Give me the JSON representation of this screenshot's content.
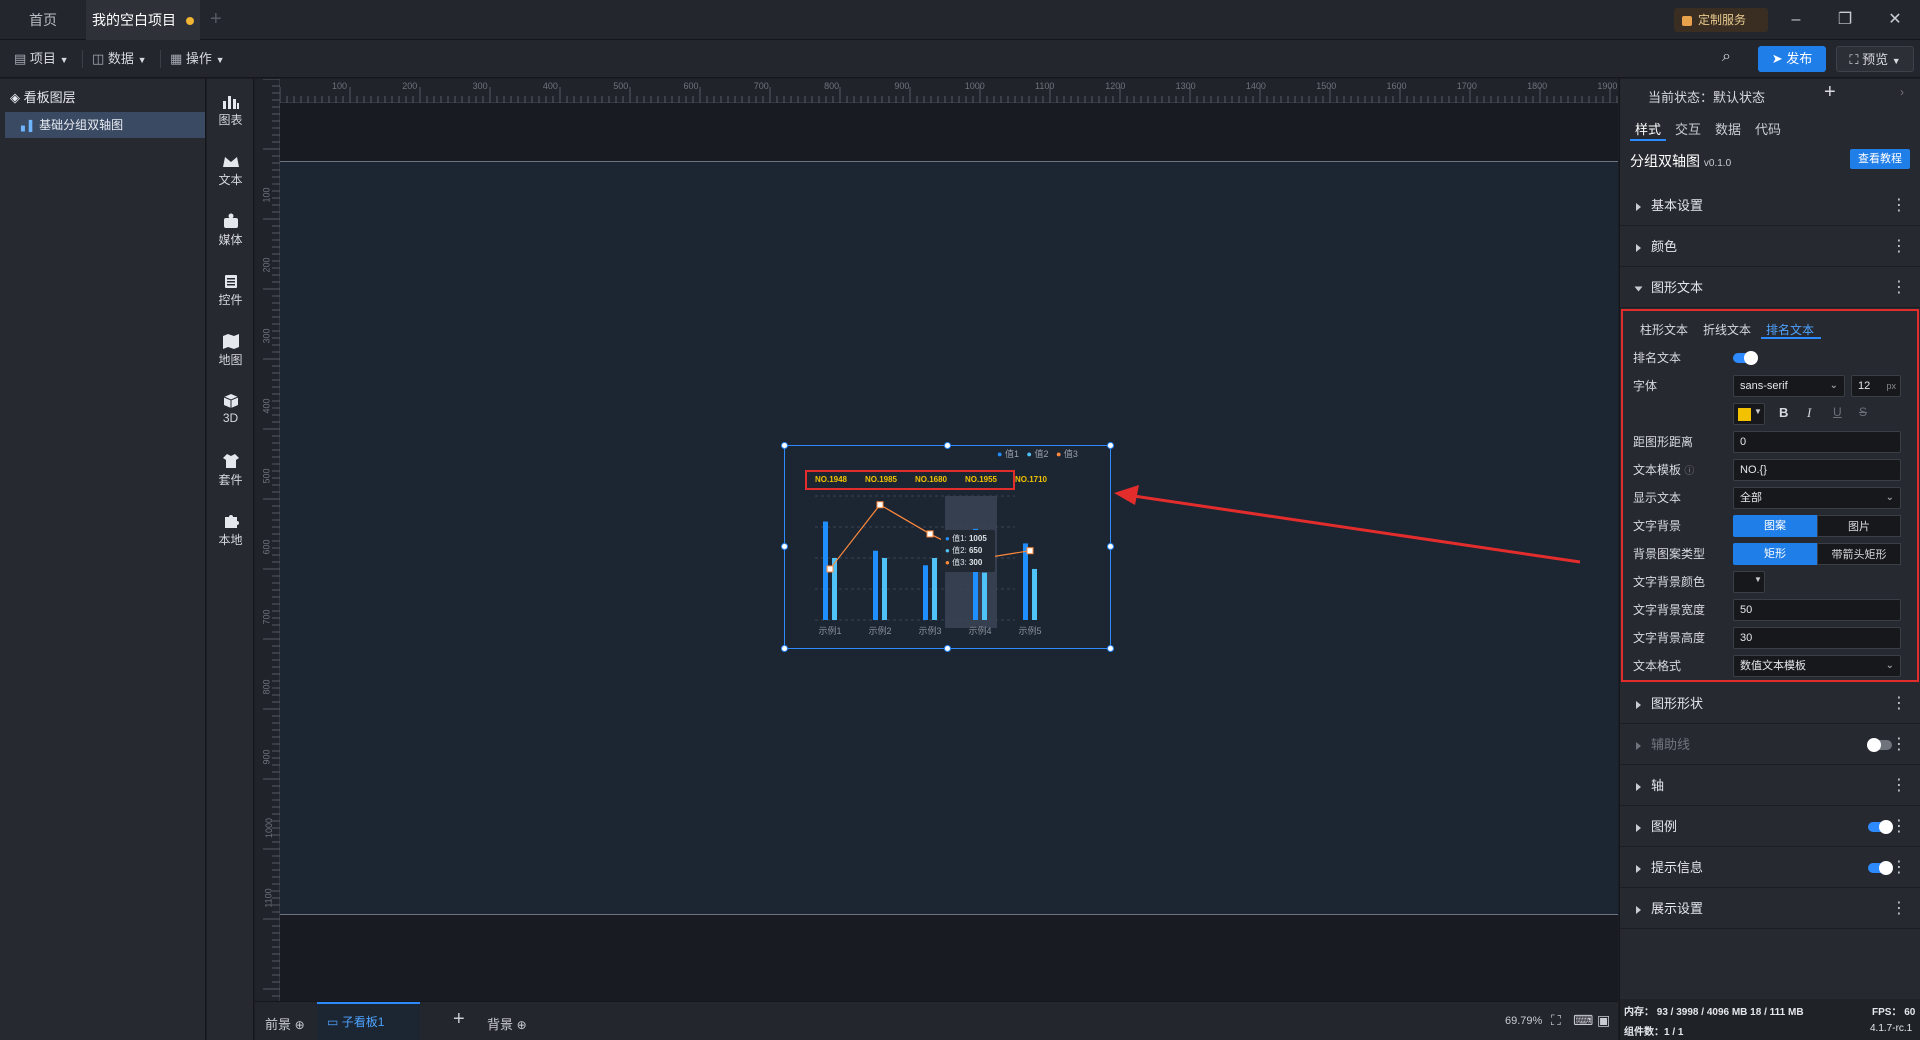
{
  "titlebar": {
    "tabs": [
      "首页",
      "我的空白项目"
    ],
    "service_label": "定制服务",
    "window_controls": [
      "minimize-icon",
      "restore-icon",
      "close-icon"
    ]
  },
  "toolbar": {
    "menus": [
      "项目",
      "数据",
      "操作"
    ],
    "publish_label": "发布",
    "preview_label": "预览"
  },
  "layers": {
    "header": "看板图层",
    "items": [
      "基础分组双轴图"
    ]
  },
  "tools": [
    "图表",
    "文本",
    "媒体",
    "控件",
    "地图",
    "3D",
    "套件",
    "本地"
  ],
  "ruler": {
    "top": [
      "100",
      "200",
      "300",
      "400",
      "500",
      "600",
      "700",
      "800",
      "900",
      "1000",
      "1100",
      "1200",
      "1300",
      "1400",
      "1500",
      "1600",
      "1700",
      "1800",
      "1900"
    ],
    "left": [
      "100",
      "200",
      "300",
      "400",
      "500",
      "600",
      "700",
      "800",
      "900",
      "1000",
      "1100"
    ]
  },
  "widget": {
    "legend": [
      "值1",
      "值2",
      "值3"
    ],
    "rank_labels": [
      "NO.1948",
      "NO.1985",
      "NO.1680",
      "NO.1955",
      "NO.1710"
    ],
    "tooltip": [
      {
        "name": "值1:",
        "value": "1005"
      },
      {
        "name": "值2:",
        "value": "650"
      },
      {
        "name": "值3:",
        "value": "300"
      }
    ]
  },
  "chart_data": {
    "type": "bar",
    "categories": [
      "示例1",
      "示例2",
      "示例3",
      "示例4",
      "示例5"
    ],
    "series": [
      {
        "name": "值1",
        "values": [
          1350,
          950,
          750,
          1250,
          1050
        ]
      },
      {
        "name": "值2",
        "values": [
          850,
          850,
          850,
          650,
          700
        ]
      },
      {
        "name": "值3",
        "values": [
          700,
          1580,
          1180,
          840,
          950
        ]
      }
    ],
    "colors": [
      "#1f8fff",
      "#4fc3f7",
      "#ff8a3d"
    ],
    "legend_position": "top-right",
    "highlight_category": "示例4"
  },
  "bottombar": {
    "tabs": [
      "前景",
      "子看板1",
      "背景"
    ],
    "zoom": "69.79%"
  },
  "statusbar": {
    "memory": "内存： 93 / 3998 / 4096 MB  18 / 111 MB",
    "fps": "FPS： 60",
    "components": "组件数：1 / 1",
    "version": "4.1.7-rc.1"
  },
  "right": {
    "state_label": "当前状态：默认状态",
    "tabs": [
      "样式",
      "交互",
      "数据",
      "代码"
    ],
    "component_name": "分组双轴图",
    "component_version": "v0.1.0",
    "tutorial_label": "查看教程",
    "sections_top": [
      "基本设置",
      "颜色",
      "图形文本"
    ],
    "sections_bottom": [
      "图形形状",
      "辅助线",
      "轴",
      "图例",
      "提示信息",
      "展示设置"
    ],
    "subtabs": [
      "柱形文本",
      "折线文本",
      "排名文本"
    ],
    "fields": {
      "rank_text": "排名文本",
      "font": "字体",
      "font_family": "sans-serif",
      "font_size": "12",
      "font_unit": "px",
      "text_color": "#f2c200",
      "distance": "距图形距离",
      "distance_value": "0",
      "template": "文本模板",
      "template_value": "NO.{}",
      "display_text": "显示文本",
      "display_value": "全部",
      "text_bg": "文字背景",
      "bg_options": [
        "图案",
        "图片"
      ],
      "bg_pattern": "背景图案类型",
      "pattern_options": [
        "矩形",
        "带箭头矩形"
      ],
      "bg_color": "文字背景颜色",
      "bg_width": "文字背景宽度",
      "bg_width_value": "50",
      "bg_height": "文字背景高度",
      "bg_height_value": "30",
      "text_format": "文本格式",
      "text_format_value": "数值文本模板"
    }
  }
}
